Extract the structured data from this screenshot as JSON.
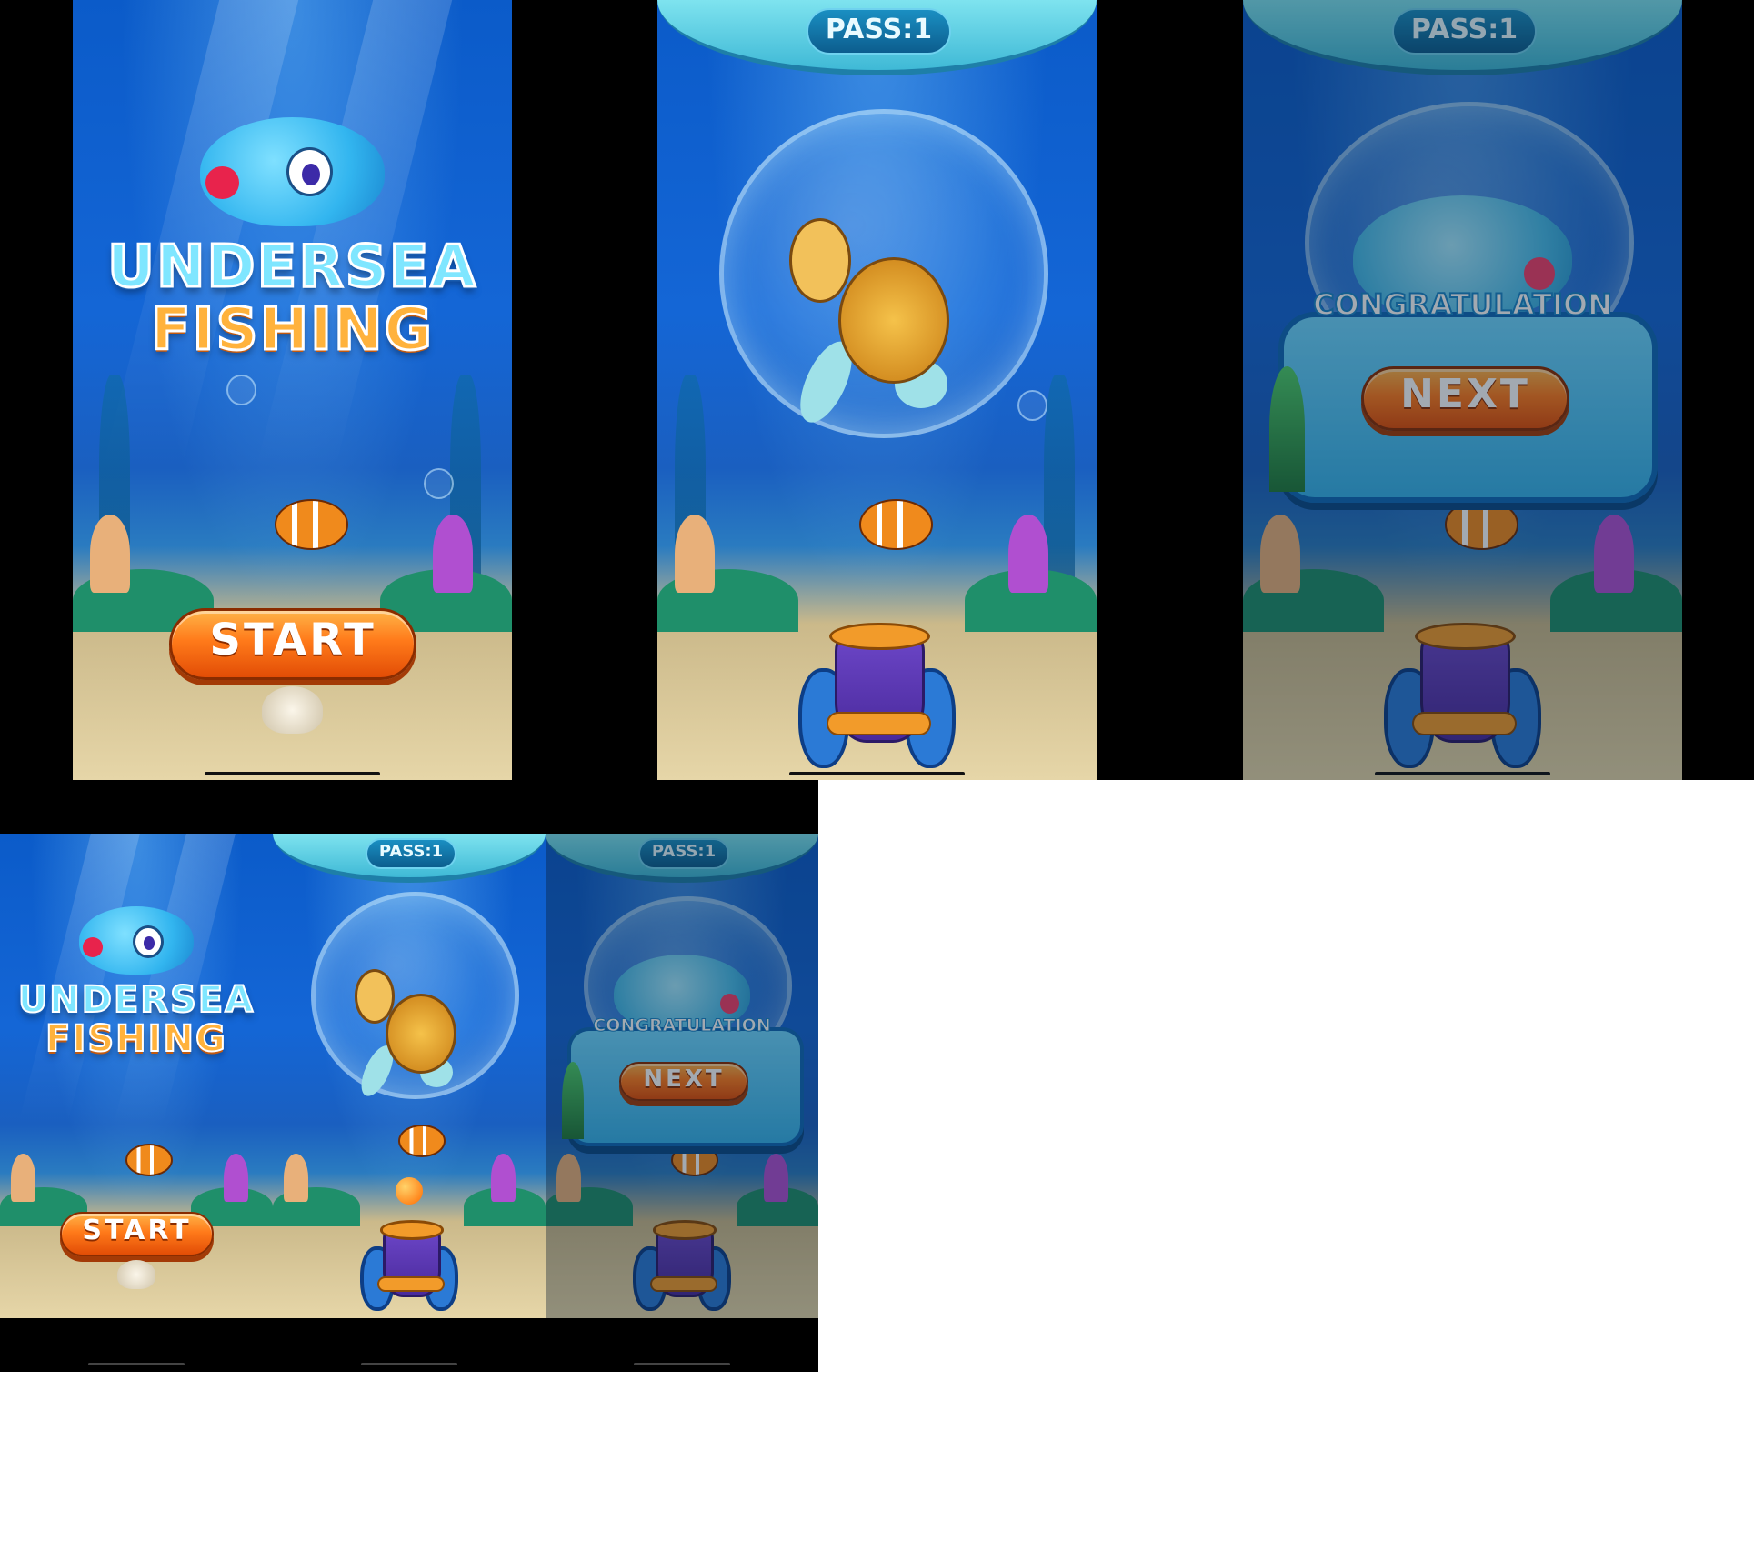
{
  "screens": {
    "start": {
      "title_line1": "UNDERSEA",
      "title_line2": "FISHING",
      "start_label": "START"
    },
    "play": {
      "pass_label": "PASS:1"
    },
    "result": {
      "pass_label": "PASS:1",
      "congrats_label": "CONGRATULATION",
      "next_label": "NEXT"
    }
  },
  "colors": {
    "accent_orange": "#ff7a1a",
    "ocean_blue": "#1466d6",
    "panel_blue": "#37b3ea"
  }
}
